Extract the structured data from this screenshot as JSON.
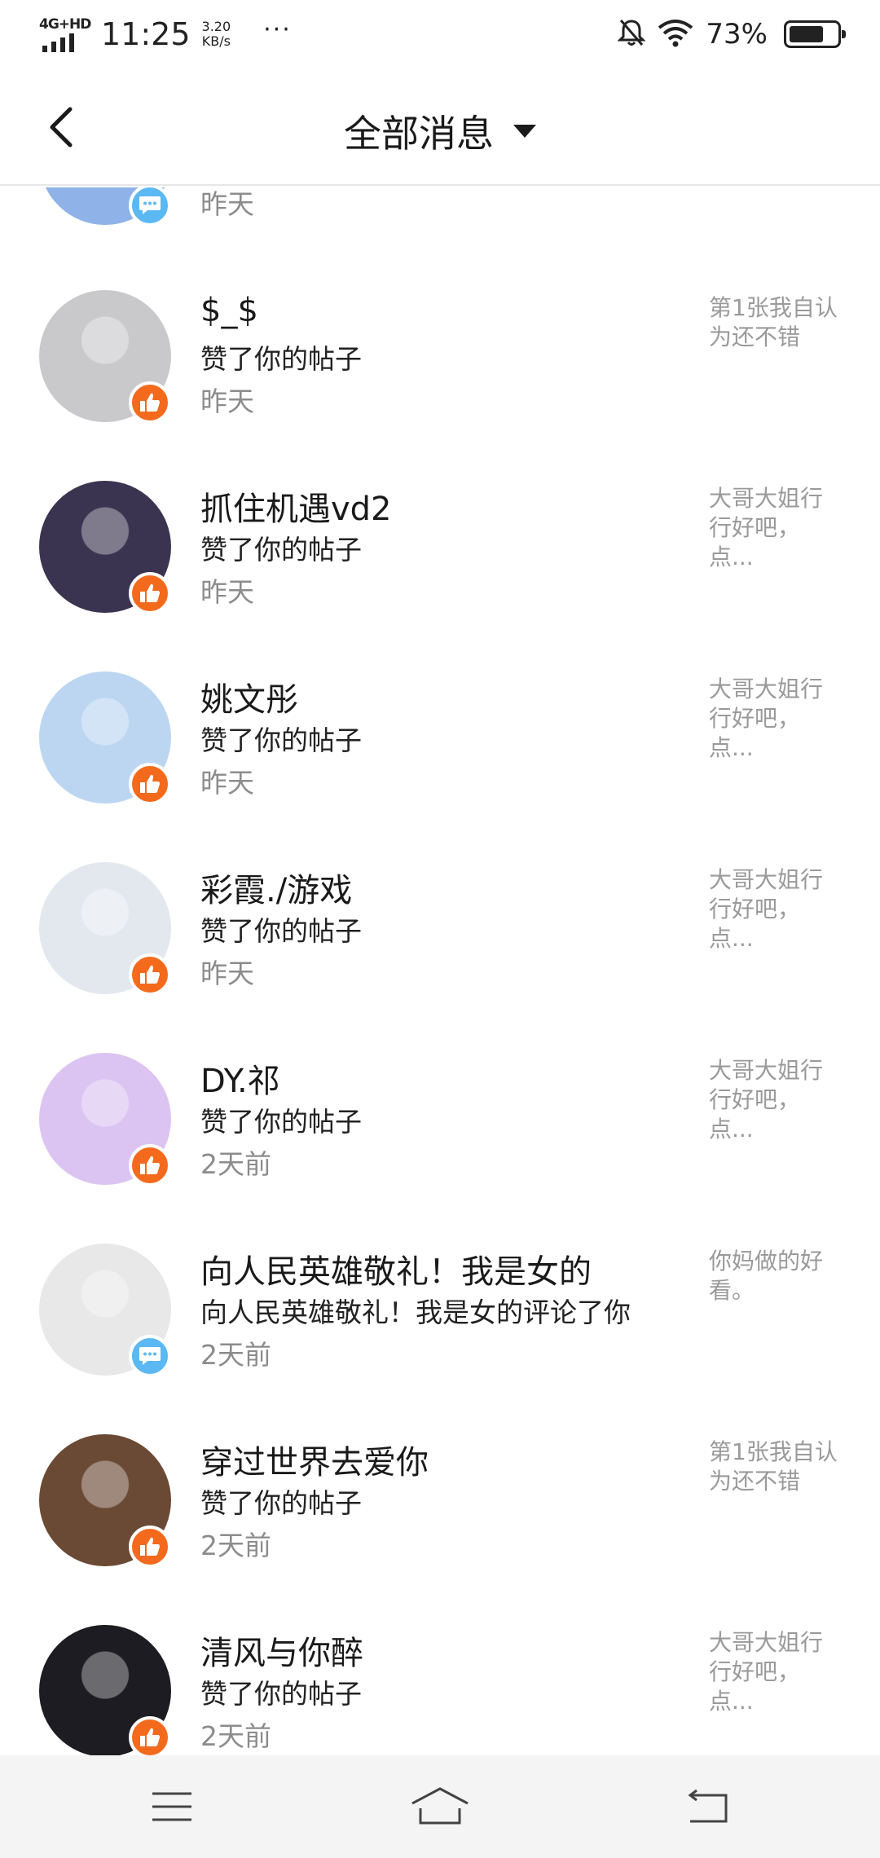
{
  "status_bar": {
    "network": "4G+HD",
    "time": "11:25",
    "speed_value": "3.20",
    "speed_unit": "KB/s",
    "more": "···",
    "battery_percent": "73%",
    "battery_level": 0.73
  },
  "header": {
    "title": "全部消息",
    "back_icon": "chevron-left-icon",
    "dropdown_icon": "caret-down-icon"
  },
  "partial_item": {
    "time": "昨天",
    "badge": "comment",
    "avatar_color": "#8fb3e8"
  },
  "items": [
    {
      "name": "$_$",
      "action": "赞了你的帖子",
      "time": "昨天",
      "snippet": "第1张我自认为还不错",
      "badge": "like",
      "avatar_color": "#c9c9cc"
    },
    {
      "name": "抓住机遇vd2",
      "action": "赞了你的帖子",
      "time": "昨天",
      "snippet": "大哥大姐行行好吧，点...",
      "badge": "like",
      "avatar_color": "#3b3450"
    },
    {
      "name": "姚文彤",
      "action": "赞了你的帖子",
      "time": "昨天",
      "snippet": "大哥大姐行行好吧，点...",
      "badge": "like",
      "avatar_color": "#bcd6f2"
    },
    {
      "name": "彩霞./游戏",
      "action": "赞了你的帖子",
      "time": "昨天",
      "snippet": "大哥大姐行行好吧，点...",
      "badge": "like",
      "avatar_color": "#e3e8ef"
    },
    {
      "name": "DY.祁",
      "action": "赞了你的帖子",
      "time": "2天前",
      "snippet": "大哥大姐行行好吧，点...",
      "badge": "like",
      "avatar_color": "#dcc4f2"
    },
    {
      "name": "向人民英雄敬礼！我是女的",
      "action": "向人民英雄敬礼！我是女的评论了你",
      "time": "2天前",
      "snippet": "你妈做的好看。",
      "badge": "comment",
      "avatar_color": "#e8e8e8"
    },
    {
      "name": "穿过世界去爱你",
      "action": "赞了你的帖子",
      "time": "2天前",
      "snippet": "第1张我自认为还不错",
      "badge": "like",
      "avatar_color": "#6b4a35"
    },
    {
      "name": "清风与你醉",
      "action": "赞了你的帖子",
      "time": "2天前",
      "snippet": "大哥大姐行行好吧，点...",
      "badge": "like",
      "avatar_color": "#1c1c22"
    }
  ],
  "bottom_nav": {
    "menu_icon": "menu-icon",
    "home_icon": "home-icon",
    "back_icon": "back-icon"
  },
  "colors": {
    "like_badge": "#f46a1c",
    "comment_badge": "#5cb8f2",
    "secondary_text": "#8c8c8c"
  }
}
